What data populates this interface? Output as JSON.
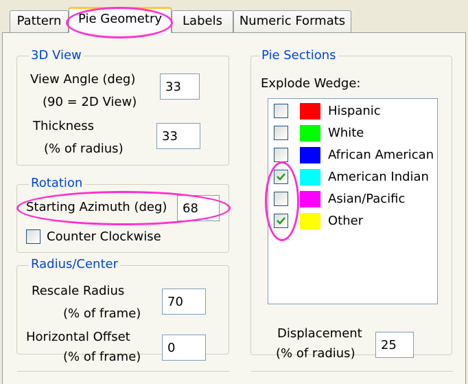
{
  "tabs": [
    {
      "label": "Pattern"
    },
    {
      "label": "Pie Geometry"
    },
    {
      "label": "Labels"
    },
    {
      "label": "Numeric Formats"
    }
  ],
  "view3d": {
    "legend": "3D View",
    "view_angle_label_line1": "View Angle (deg)",
    "view_angle_label_line2": "(90 = 2D View)",
    "view_angle_value": "33",
    "thickness_label_line1": "Thickness",
    "thickness_label_line2": "(% of radius)",
    "thickness_value": "33"
  },
  "rotation": {
    "legend": "Rotation",
    "starting_azimuth_label": "Starting Azimuth (deg)",
    "starting_azimuth_value": "68",
    "counter_clockwise_label": "Counter Clockwise",
    "counter_clockwise_checked": false
  },
  "radius_center": {
    "legend": "Radius/Center",
    "rescale_label_line1": "Rescale Radius",
    "rescale_label_line2": "(% of frame)",
    "rescale_value": "70",
    "hoffset_label_line1": "Horizontal Offset",
    "hoffset_label_line2": "(% of frame)",
    "hoffset_value": "0"
  },
  "pie_sections": {
    "legend": "Pie Sections",
    "explode_label": "Explode Wedge:",
    "items": [
      {
        "label": "Hispanic",
        "color": "#ff0000",
        "checked": false
      },
      {
        "label": "White",
        "color": "#00ff00",
        "checked": false
      },
      {
        "label": "African American",
        "color": "#0000ff",
        "checked": false
      },
      {
        "label": "American Indian",
        "color": "#00ffff",
        "checked": true
      },
      {
        "label": "Asian/Pacific",
        "color": "#ff00ff",
        "checked": false
      },
      {
        "label": "Other",
        "color": "#ffff00",
        "checked": true
      }
    ],
    "displacement_label_line1": "Displacement",
    "displacement_label_line2": "(% of radius)",
    "displacement_value": "25"
  }
}
